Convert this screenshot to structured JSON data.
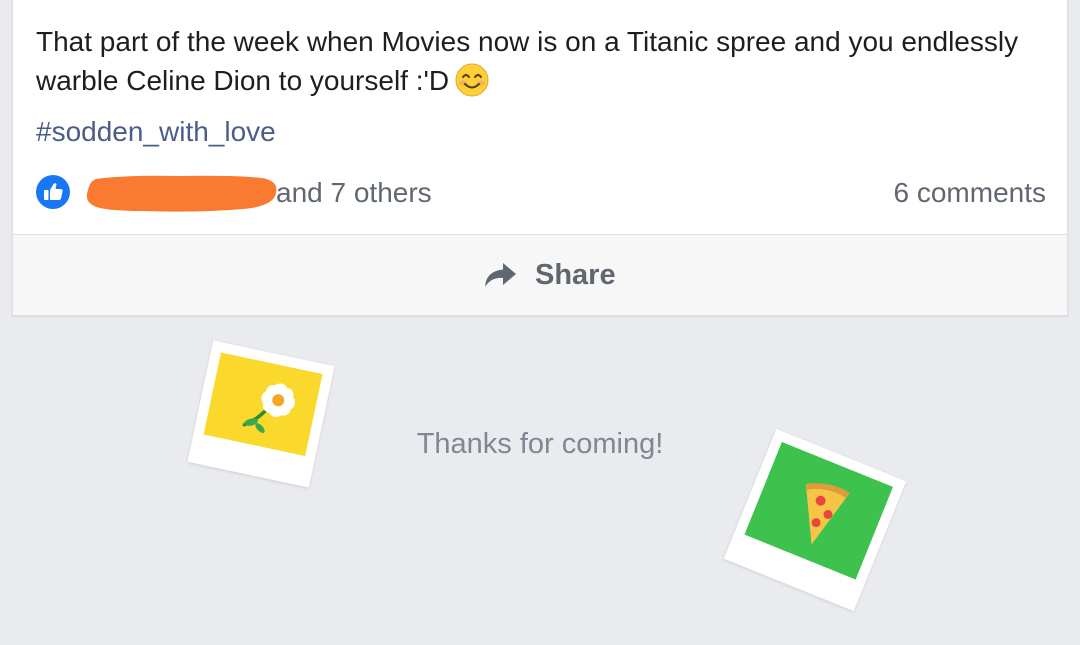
{
  "post": {
    "text": "That part of the week when Movies now is on a Titanic spree and you endlessly warble Celine Dion to yourself :'D",
    "emoji": "smiling-face-emoji",
    "hashtag": "#sodden_with_love",
    "reactions": {
      "icon": "like-icon",
      "others_text": "and 7 others"
    },
    "comments_count": "6 comments",
    "actions": {
      "share_label": "Share",
      "share_icon": "share-arrow-icon"
    }
  },
  "footer": {
    "message": "Thanks for coming!",
    "decorations": [
      "flower-polaroid",
      "pizza-polaroid"
    ]
  },
  "colors": {
    "background": "#e9ebee",
    "text": "#1c1e21",
    "secondary_text": "#606770",
    "hashtag": "#4b5d88",
    "like_blue": "#1877f2",
    "redaction": "#f97a30",
    "flower_card": "#fad92c",
    "pizza_card": "#3ec24e"
  }
}
